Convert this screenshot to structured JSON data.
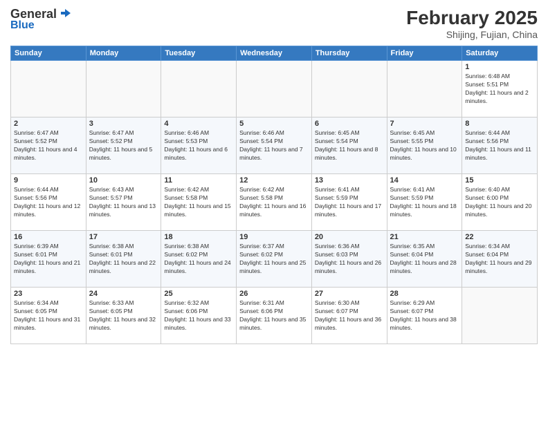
{
  "logo": {
    "general": "General",
    "blue": "Blue"
  },
  "header": {
    "month": "February 2025",
    "location": "Shijing, Fujian, China"
  },
  "weekdays": [
    "Sunday",
    "Monday",
    "Tuesday",
    "Wednesday",
    "Thursday",
    "Friday",
    "Saturday"
  ],
  "weeks": [
    [
      {
        "day": "",
        "info": ""
      },
      {
        "day": "",
        "info": ""
      },
      {
        "day": "",
        "info": ""
      },
      {
        "day": "",
        "info": ""
      },
      {
        "day": "",
        "info": ""
      },
      {
        "day": "",
        "info": ""
      },
      {
        "day": "1",
        "info": "Sunrise: 6:48 AM\nSunset: 5:51 PM\nDaylight: 11 hours and 2 minutes."
      }
    ],
    [
      {
        "day": "2",
        "info": "Sunrise: 6:47 AM\nSunset: 5:52 PM\nDaylight: 11 hours and 4 minutes."
      },
      {
        "day": "3",
        "info": "Sunrise: 6:47 AM\nSunset: 5:52 PM\nDaylight: 11 hours and 5 minutes."
      },
      {
        "day": "4",
        "info": "Sunrise: 6:46 AM\nSunset: 5:53 PM\nDaylight: 11 hours and 6 minutes."
      },
      {
        "day": "5",
        "info": "Sunrise: 6:46 AM\nSunset: 5:54 PM\nDaylight: 11 hours and 7 minutes."
      },
      {
        "day": "6",
        "info": "Sunrise: 6:45 AM\nSunset: 5:54 PM\nDaylight: 11 hours and 8 minutes."
      },
      {
        "day": "7",
        "info": "Sunrise: 6:45 AM\nSunset: 5:55 PM\nDaylight: 11 hours and 10 minutes."
      },
      {
        "day": "8",
        "info": "Sunrise: 6:44 AM\nSunset: 5:56 PM\nDaylight: 11 hours and 11 minutes."
      }
    ],
    [
      {
        "day": "9",
        "info": "Sunrise: 6:44 AM\nSunset: 5:56 PM\nDaylight: 11 hours and 12 minutes."
      },
      {
        "day": "10",
        "info": "Sunrise: 6:43 AM\nSunset: 5:57 PM\nDaylight: 11 hours and 13 minutes."
      },
      {
        "day": "11",
        "info": "Sunrise: 6:42 AM\nSunset: 5:58 PM\nDaylight: 11 hours and 15 minutes."
      },
      {
        "day": "12",
        "info": "Sunrise: 6:42 AM\nSunset: 5:58 PM\nDaylight: 11 hours and 16 minutes."
      },
      {
        "day": "13",
        "info": "Sunrise: 6:41 AM\nSunset: 5:59 PM\nDaylight: 11 hours and 17 minutes."
      },
      {
        "day": "14",
        "info": "Sunrise: 6:41 AM\nSunset: 5:59 PM\nDaylight: 11 hours and 18 minutes."
      },
      {
        "day": "15",
        "info": "Sunrise: 6:40 AM\nSunset: 6:00 PM\nDaylight: 11 hours and 20 minutes."
      }
    ],
    [
      {
        "day": "16",
        "info": "Sunrise: 6:39 AM\nSunset: 6:01 PM\nDaylight: 11 hours and 21 minutes."
      },
      {
        "day": "17",
        "info": "Sunrise: 6:38 AM\nSunset: 6:01 PM\nDaylight: 11 hours and 22 minutes."
      },
      {
        "day": "18",
        "info": "Sunrise: 6:38 AM\nSunset: 6:02 PM\nDaylight: 11 hours and 24 minutes."
      },
      {
        "day": "19",
        "info": "Sunrise: 6:37 AM\nSunset: 6:02 PM\nDaylight: 11 hours and 25 minutes."
      },
      {
        "day": "20",
        "info": "Sunrise: 6:36 AM\nSunset: 6:03 PM\nDaylight: 11 hours and 26 minutes."
      },
      {
        "day": "21",
        "info": "Sunrise: 6:35 AM\nSunset: 6:04 PM\nDaylight: 11 hours and 28 minutes."
      },
      {
        "day": "22",
        "info": "Sunrise: 6:34 AM\nSunset: 6:04 PM\nDaylight: 11 hours and 29 minutes."
      }
    ],
    [
      {
        "day": "23",
        "info": "Sunrise: 6:34 AM\nSunset: 6:05 PM\nDaylight: 11 hours and 31 minutes."
      },
      {
        "day": "24",
        "info": "Sunrise: 6:33 AM\nSunset: 6:05 PM\nDaylight: 11 hours and 32 minutes."
      },
      {
        "day": "25",
        "info": "Sunrise: 6:32 AM\nSunset: 6:06 PM\nDaylight: 11 hours and 33 minutes."
      },
      {
        "day": "26",
        "info": "Sunrise: 6:31 AM\nSunset: 6:06 PM\nDaylight: 11 hours and 35 minutes."
      },
      {
        "day": "27",
        "info": "Sunrise: 6:30 AM\nSunset: 6:07 PM\nDaylight: 11 hours and 36 minutes."
      },
      {
        "day": "28",
        "info": "Sunrise: 6:29 AM\nSunset: 6:07 PM\nDaylight: 11 hours and 38 minutes."
      },
      {
        "day": "",
        "info": ""
      }
    ]
  ]
}
